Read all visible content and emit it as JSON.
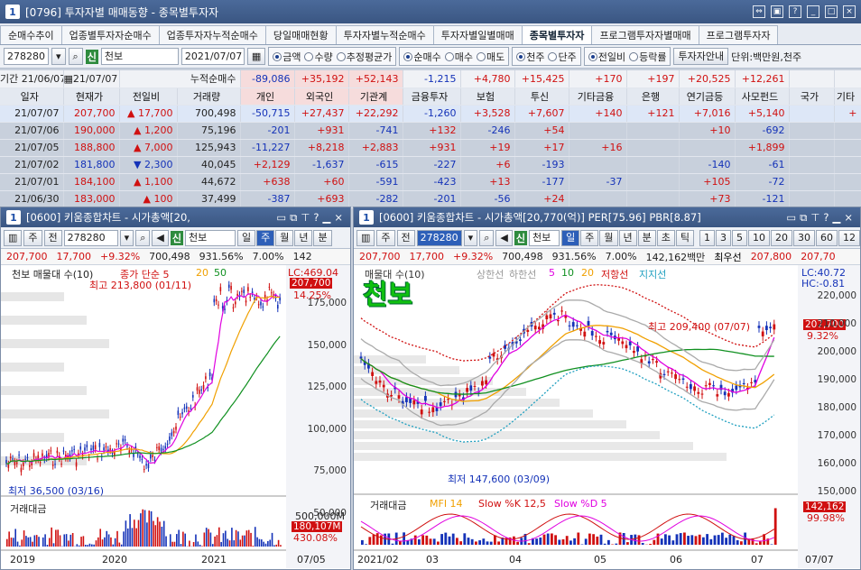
{
  "window": {
    "num": "1",
    "title": "[0796] 투자자별 매매동향 - 종목별투자자"
  },
  "tabs": [
    "순매수추이",
    "업종별투자자순매수",
    "업종투자자누적순매수",
    "당일매매현황",
    "투자자별누적순매수",
    "투자자별일별매매",
    "종목별투자자",
    "프로그램투자자별매매",
    "프로그램투자자"
  ],
  "active_tab": 6,
  "controls": {
    "code": "278280",
    "sin": "신",
    "name": "천보",
    "date": "2021/07/07",
    "r1": [
      "금액",
      "수량",
      "추정평균가"
    ],
    "r2": [
      "순매수",
      "매수",
      "매도"
    ],
    "r3": [
      "천주",
      "단주"
    ],
    "r4": [
      "전일비",
      "등락률"
    ],
    "btn": "투자자안내",
    "unit": "단위:백만원,천주"
  },
  "sumrow": {
    "label": "기간",
    "from": "21/06/07",
    "to": "21/07/07",
    "tag": "누적순매수",
    "vals": [
      "-89,086",
      "+35,192",
      "+52,143",
      "-1,215",
      "+4,780",
      "+15,425",
      "+170",
      "+197",
      "+20,525",
      "+12,261"
    ]
  },
  "headers": [
    "일자",
    "현재가",
    "전일비",
    "거래량",
    "개인",
    "외국인",
    "기관계",
    "금융투자",
    "보험",
    "투신",
    "기타금융",
    "은행",
    "연기금등",
    "사모펀드",
    "국가",
    "기타"
  ],
  "rows": [
    {
      "d": "21/07/07",
      "p": "207,700",
      "ar": "▲",
      "c": "17,700",
      "v": "700,498",
      "cells": [
        "-50,715",
        "+27,437",
        "+22,292",
        "-1,260",
        "+3,528",
        "+7,607",
        "+140",
        "+121",
        "+7,016",
        "+5,140",
        "",
        "+"
      ]
    },
    {
      "d": "21/07/06",
      "p": "190,000",
      "ar": "▲",
      "c": "1,200",
      "v": "75,196",
      "cells": [
        "-201",
        "+931",
        "-741",
        "+132",
        "-246",
        "+54",
        "",
        "",
        "+10",
        "-692",
        "",
        ""
      ]
    },
    {
      "d": "21/07/05",
      "p": "188,800",
      "ar": "▲",
      "c": "7,000",
      "v": "125,943",
      "cells": [
        "-11,227",
        "+8,218",
        "+2,883",
        "+931",
        "+19",
        "+17",
        "+16",
        "",
        "",
        "+1,899",
        "",
        ""
      ]
    },
    {
      "d": "21/07/02",
      "p": "181,800",
      "ar": "▼",
      "c": "2,300",
      "v": "40,045",
      "cells": [
        "+2,129",
        "-1,637",
        "-615",
        "-227",
        "+6",
        "-193",
        "",
        "",
        "-140",
        "-61",
        "",
        ""
      ]
    },
    {
      "d": "21/07/01",
      "p": "184,100",
      "ar": "▲",
      "c": "1,100",
      "v": "44,672",
      "cells": [
        "+638",
        "+60",
        "-591",
        "-423",
        "+13",
        "-177",
        "-37",
        "",
        "+105",
        "-72",
        "",
        ""
      ]
    },
    {
      "d": "21/06/30",
      "p": "183,000",
      "ar": "▲",
      "c": "100",
      "v": "37,499",
      "cells": [
        "-387",
        "+693",
        "-282",
        "-201",
        "-56",
        "+24",
        "",
        "",
        "+73",
        "-121",
        "",
        ""
      ]
    }
  ],
  "left_chart": {
    "num": "1",
    "title": "[0600] 키움종합차트 - 시가총액[20,",
    "code": "278280",
    "sin": "신",
    "name": "천보",
    "periods": [
      "일",
      "주",
      "월",
      "년",
      "분"
    ],
    "active_period": "주",
    "info": [
      "207,700",
      "17,700",
      "+9.32%",
      "700,498",
      "931.56%",
      "7.00%",
      "142"
    ],
    "legend_label": "천보 매물대 수(10)",
    "legend_ma": [
      "종가 단순 5",
      "20",
      "50"
    ],
    "lc": "LC:469.04",
    "price_tag": "207,700",
    "pct_tag": "14.25%",
    "hi_label": "최고 213,800 (01/11)",
    "lo_label": "최저 36,500 (03/16)",
    "y_ticks": [
      "175,000",
      "150,000",
      "125,000",
      "100,000",
      "75,000",
      "50,000"
    ],
    "vol_label": "거래대금",
    "vol_tag": "180,107M",
    "vol_tag2": "430.08%",
    "vol_tick": "500,000M",
    "x_ticks": [
      "2019",
      "2020",
      "2021",
      "07/05"
    ]
  },
  "right_chart": {
    "num": "1",
    "title": "[0600] 키움종합차트 - 시가총액[20,770(억)] PER[75.96] PBR[8.87]",
    "code": "278280",
    "sin": "신",
    "name": "천보",
    "periods": [
      "일",
      "주",
      "월",
      "년",
      "분",
      "초",
      "틱"
    ],
    "active_period": "일",
    "nums": [
      "1",
      "3",
      "5",
      "10",
      "20",
      "30",
      "60",
      "12"
    ],
    "info": [
      "207,700",
      "17,700",
      "+9.32%",
      "700,498",
      "931.56%",
      "7.00%",
      "142,162백만",
      "최우선",
      "207,800",
      "207,70"
    ],
    "big_name": "천보",
    "legend": [
      "매물대 수(10)",
      "상한선",
      "하한선",
      "5",
      "10",
      "20",
      "저항선",
      "지지선"
    ],
    "lc": "LC:40.72",
    "hc": "HC:-0.81",
    "price_tag": "207,700",
    "pct_tag": "9.32%",
    "hi_label": "최고 209,400 (07/07)",
    "lo_label": "최저 147,600 (03/09)",
    "y_ticks": [
      "220,000",
      "210,000",
      "200,000",
      "190,000",
      "180,000",
      "170,000",
      "160,000",
      "150,000"
    ],
    "vol_legend": [
      "거래대금",
      "MFI 14",
      "Slow %K 12,5",
      "Slow %D 5"
    ],
    "vol_tag": "142,162",
    "vol_tag2": "99.98%",
    "x_ticks": [
      "2021/02",
      "03",
      "04",
      "05",
      "06",
      "07",
      "07/07"
    ]
  },
  "colors": {
    "up": "#d01010",
    "down": "#1432b8",
    "ma5": "#e000e0",
    "ma20": "#f0a000",
    "ma50": "#109020"
  }
}
